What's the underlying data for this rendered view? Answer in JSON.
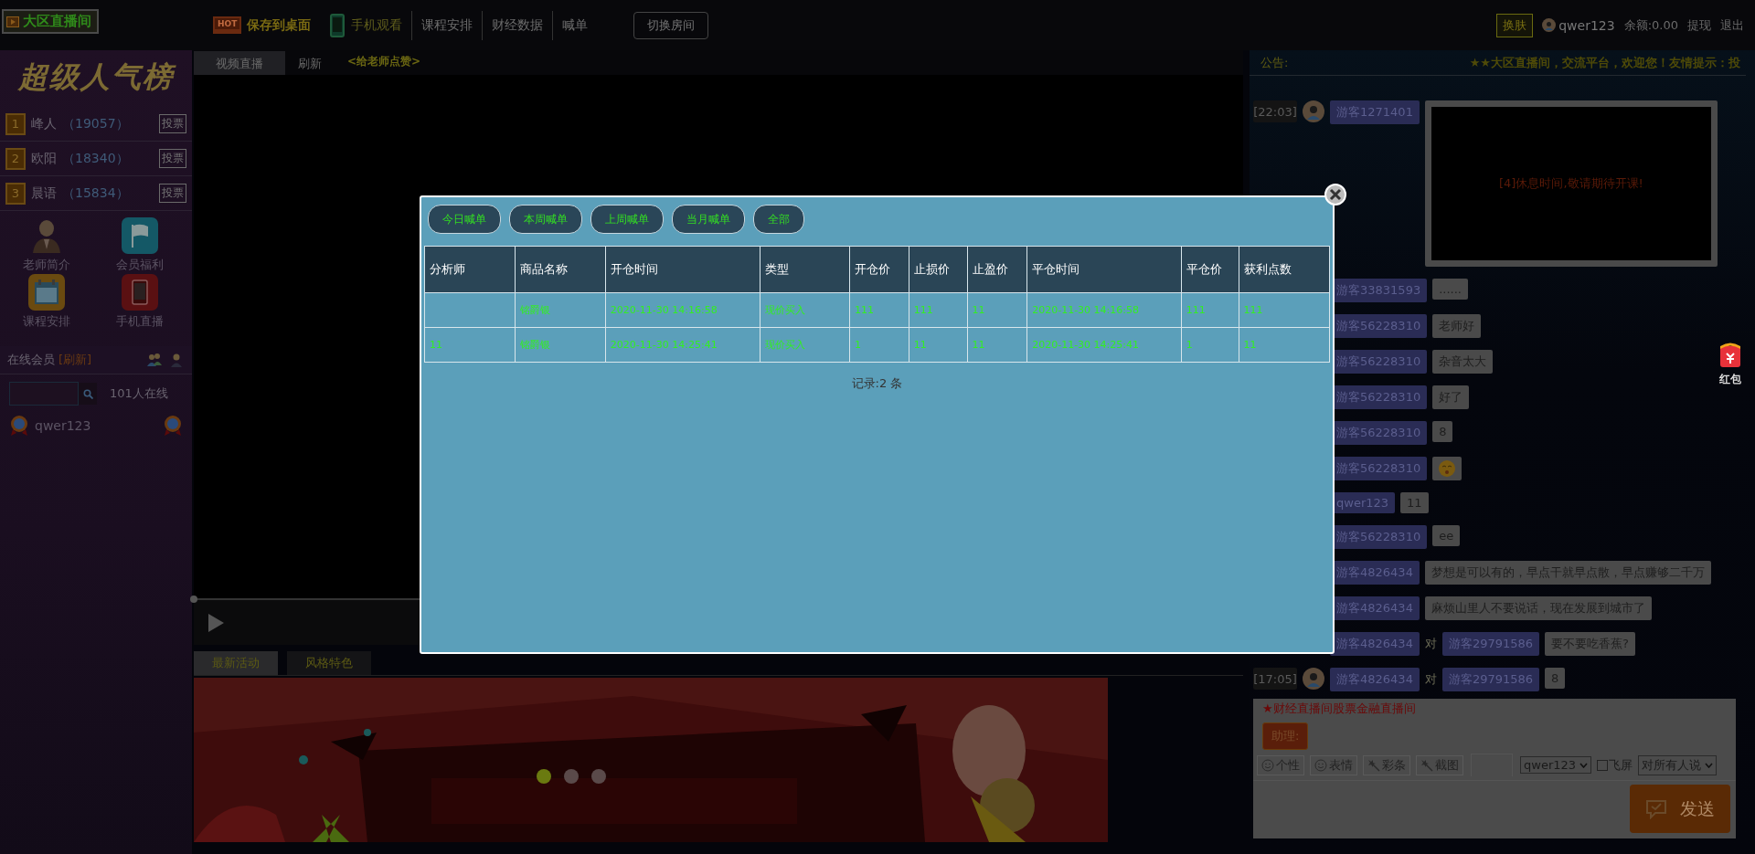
{
  "header": {
    "logo": "大区直播间",
    "nav": [
      {
        "kind": "hot",
        "badge": "HOT",
        "label": "保存到桌面"
      },
      {
        "kind": "phone",
        "label": "手机观看"
      },
      {
        "kind": "plain",
        "label": "课程安排"
      },
      {
        "kind": "plain",
        "label": "财经数据"
      },
      {
        "kind": "plain",
        "label": "喊单"
      }
    ],
    "room_button": "切换房间",
    "skin_button": "换肤",
    "user": "qwer123",
    "balance": "余额:0.00",
    "links": [
      "提现",
      "退出"
    ]
  },
  "sidebar": {
    "title": "超级人气榜",
    "ranks": [
      {
        "rank": "1",
        "name": "峰人",
        "votes": "（19057）",
        "button": "投票"
      },
      {
        "rank": "2",
        "name": "欧阳",
        "votes": "（18340）",
        "button": "投票"
      },
      {
        "rank": "3",
        "name": "晨语",
        "votes": "（15834）",
        "button": "投票"
      }
    ],
    "shortcuts": [
      {
        "kind": "teacher",
        "label": "老师简介"
      },
      {
        "kind": "flag",
        "label": "会员福利"
      },
      {
        "kind": "calendar",
        "label": "课程安排"
      },
      {
        "kind": "mobile",
        "label": "手机直播"
      }
    ],
    "online": {
      "title": "在线会员",
      "refresh": "[刷新]",
      "count": "101人在线",
      "users": [
        "qwer123"
      ]
    }
  },
  "video": {
    "tabs": [
      {
        "label": "视频直播",
        "selected": true
      },
      {
        "label": "刷新",
        "selected": false
      }
    ],
    "like_link": "<给老师点赞>",
    "activity_tabs": [
      {
        "label": "最新活动",
        "selected": true
      },
      {
        "label": "风格特色",
        "selected": false
      }
    ],
    "banner": {
      "kind": "picture",
      "dots": [
        {
          "selected": true
        },
        {
          "selected": false
        },
        {
          "selected": false
        }
      ]
    }
  },
  "chat": {
    "notice_label": "公告:",
    "notice": "★★大区直播间，交流平台，欢迎您！友情提示：投",
    "messages": [
      {
        "time": "[22:03]",
        "avatar": true,
        "name": "游客1271401",
        "text": "[4]休息时间,敬请期待开课!"
      },
      {
        "name": "游客33831593",
        "kind": "text",
        "text": "......"
      },
      {
        "name": "游客56228310",
        "kind": "text",
        "text": "老师好"
      },
      {
        "name": "游客56228310",
        "kind": "text",
        "text": "杂音太大"
      },
      {
        "name": "游客56228310",
        "kind": "text",
        "text": "好了"
      },
      {
        "name": "游客56228310",
        "kind": "text",
        "text": "8"
      },
      {
        "name": "游客56228310",
        "kind": "emoji"
      },
      {
        "name": "qwer123",
        "kind": "text",
        "text": "11"
      },
      {
        "name": "游客56228310",
        "kind": "text",
        "text": "ee"
      },
      {
        "name": "游客4826434",
        "kind": "text",
        "text": "梦想是可以有的，早点干就早点散，早点赚够二千万"
      },
      {
        "name": "游客4826434",
        "kind": "text",
        "text": "麻烦山里人不要说话，现在发展到城市了"
      },
      {
        "name": "游客4826434",
        "to_word": "对",
        "to": "游客29791586",
        "kind": "text",
        "text": "要不要吃香蕉?"
      },
      {
        "time": "[17:05]",
        "avatar": true,
        "name": "游客4826434",
        "to_word": "对",
        "to": "游客29791586",
        "kind": "text",
        "text": "8"
      }
    ],
    "input": {
      "banner": "★财经直播间股票金融直播间",
      "assistant_button": "助理:",
      "tools": [
        {
          "kind": "smile",
          "label": "个性"
        },
        {
          "kind": "smile",
          "label": "表情"
        },
        {
          "kind": "wand",
          "label": "彩条"
        },
        {
          "kind": "wand",
          "label": "截图"
        }
      ],
      "user_select": "qwer123",
      "fly_screen": {
        "label": "飞屏",
        "checked": false
      },
      "target_select": "对所有人说",
      "send": "发送"
    }
  },
  "red_packet": "红包",
  "modal": {
    "filters": [
      "今日喊单",
      "本周喊单",
      "上周喊单",
      "当月喊单",
      "全部"
    ],
    "columns": [
      "分析师",
      "商品名称",
      "开仓时间",
      "类型",
      "开仓价",
      "止损价",
      "止盈价",
      "平仓时间",
      "平仓价",
      "获利点数"
    ],
    "rows": [
      {
        "cells": [
          null,
          "铭爵银",
          "2020-11-30 14:16:58",
          "现价买入",
          "111",
          "111",
          "11",
          "2020-11-30 14:16:58",
          "111",
          "111"
        ]
      },
      {
        "cells": [
          "11",
          "铭爵银",
          "2020-11-30 14:25:41",
          "现价买入",
          "1",
          "11",
          "11",
          "2020-11-30 14:25:41",
          "1",
          "11"
        ]
      }
    ],
    "footer": "记录:2 条"
  }
}
